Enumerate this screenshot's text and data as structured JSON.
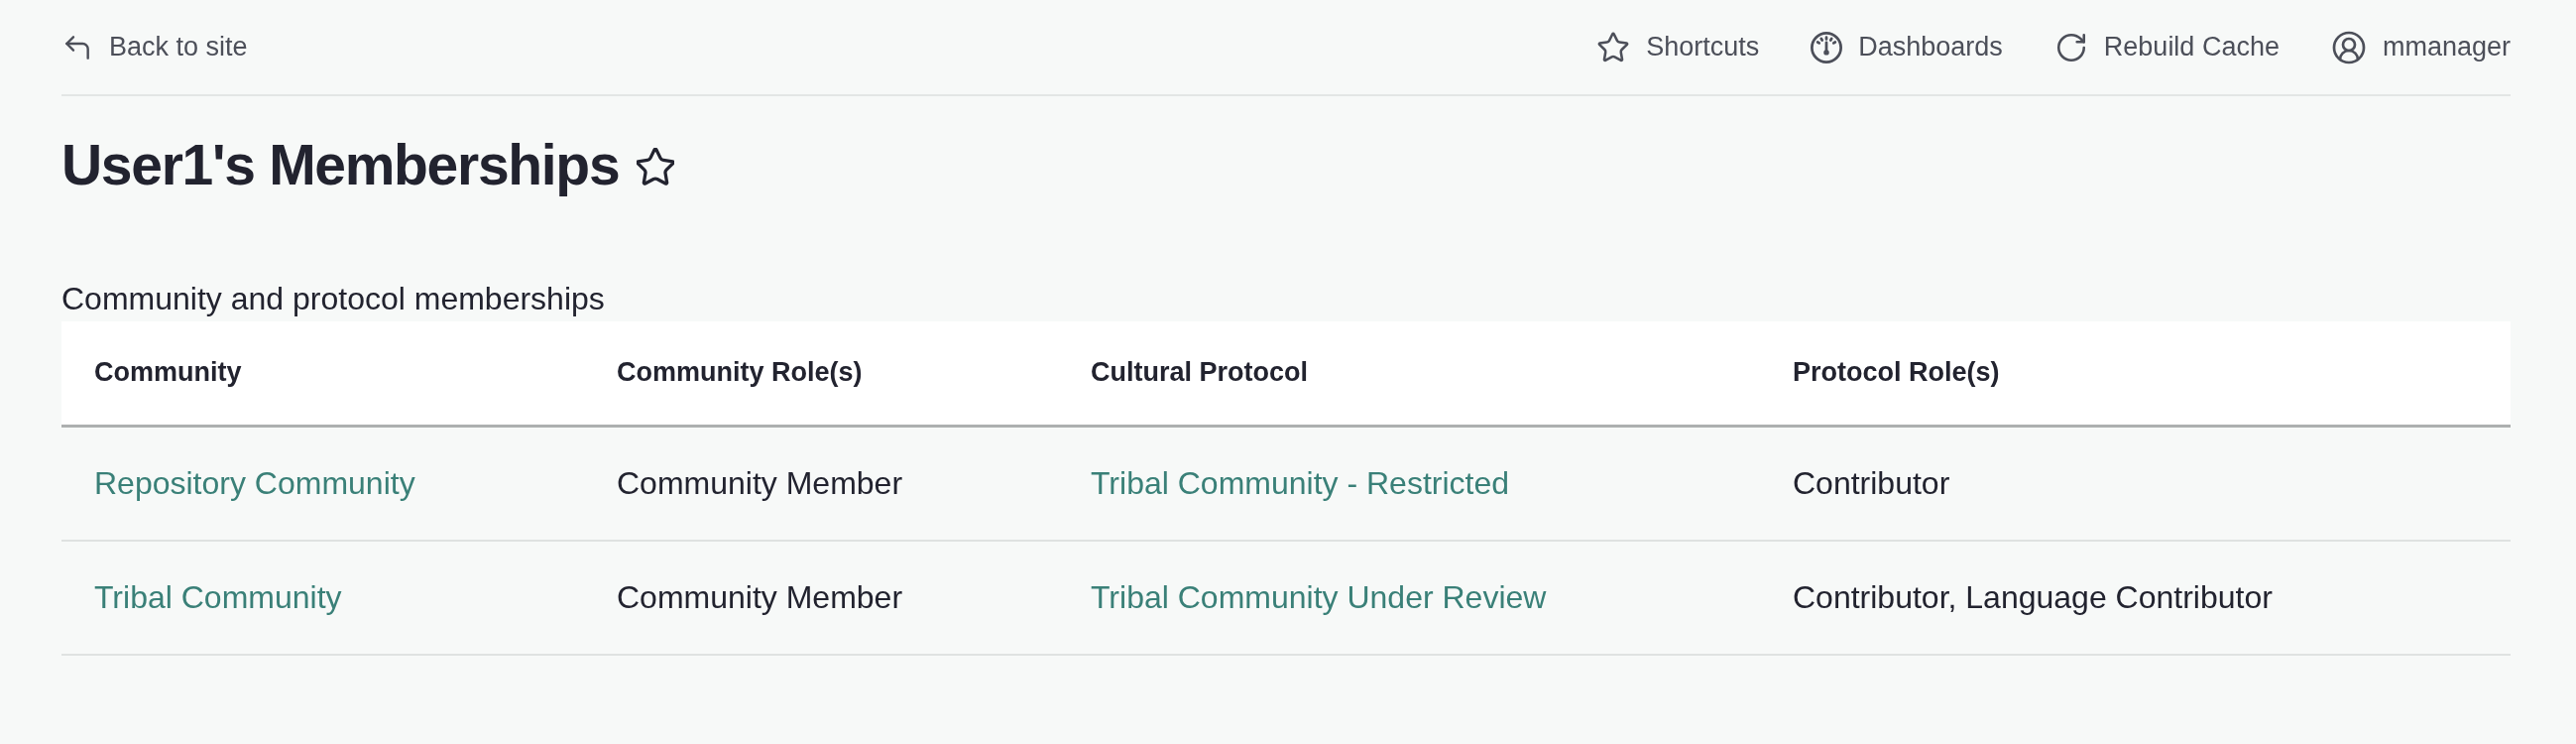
{
  "top_bar": {
    "back_link": "Back to site",
    "nav_items": [
      {
        "kind": "shortcuts",
        "label": "Shortcuts"
      },
      {
        "kind": "dashboards",
        "label": "Dashboards"
      },
      {
        "kind": "rebuild",
        "label": "Rebuild Cache"
      },
      {
        "kind": "account",
        "label": "mmanager"
      }
    ]
  },
  "page": {
    "title": "User1's Memberships",
    "favorited": false
  },
  "memberships_table": {
    "caption": "Community and protocol memberships",
    "columns": [
      "Community",
      "Community Role(s)",
      "Cultural Protocol",
      "Protocol Role(s)"
    ],
    "rows": [
      {
        "community": "Repository Community",
        "community_roles": "Community Member",
        "cultural_protocol": "Tribal Community - Restricted",
        "protocol_roles": "Contributor"
      },
      {
        "community": "Tribal Community",
        "community_roles": "Community Member",
        "cultural_protocol": "Tribal Community Under Review",
        "protocol_roles": "Contributor, Language Contributor"
      }
    ]
  }
}
